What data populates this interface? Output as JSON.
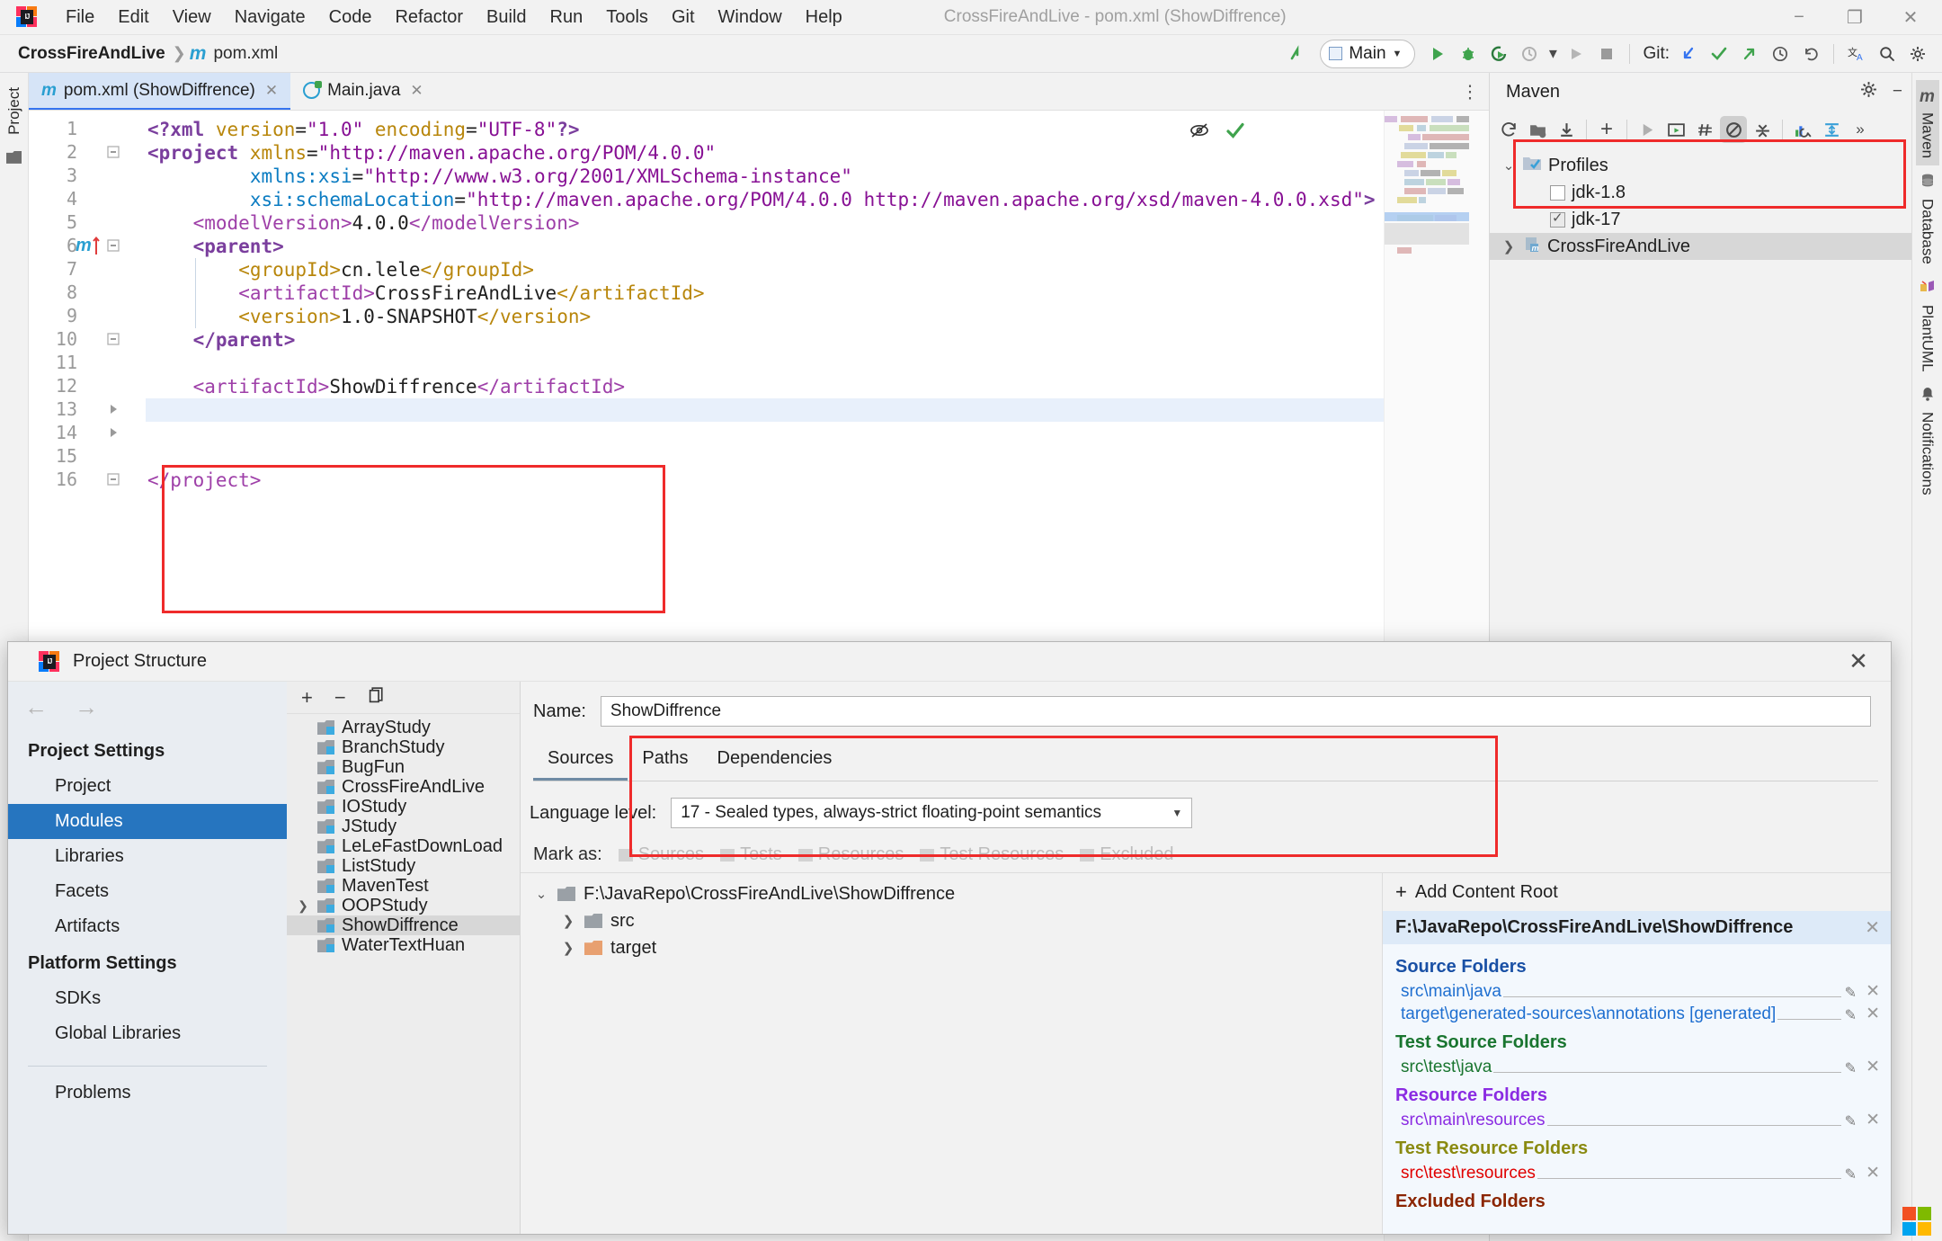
{
  "window": {
    "title": "CrossFireAndLive - pom.xml (ShowDiffrence)",
    "minimize": "−",
    "maximize": "❐",
    "close": "✕"
  },
  "menubar": [
    "File",
    "Edit",
    "View",
    "Navigate",
    "Code",
    "Refactor",
    "Build",
    "Run",
    "Tools",
    "Git",
    "Window",
    "Help"
  ],
  "navbar": {
    "breadcrumb_project": "CrossFireAndLive",
    "breadcrumb_sep": "❯",
    "breadcrumb_file": "pom.xml",
    "run_config": "Main",
    "git_label": "Git:"
  },
  "left_rail": {
    "project_tab": "Project"
  },
  "editor": {
    "tabs": [
      {
        "label": "pom.xml (ShowDiffrence)",
        "icon": "maven-xml-icon",
        "active": true
      },
      {
        "label": "Main.java",
        "icon": "java-class-icon",
        "active": false
      }
    ],
    "caret_line": 13,
    "lines": [
      {
        "n": 1,
        "segments": [
          {
            "t": "<?xml ",
            "c": "k-proc"
          },
          {
            "t": "version",
            "c": "k-orange"
          },
          {
            "t": "=",
            "c": "k-txt"
          },
          {
            "t": "\"1.0\"",
            "c": "k-purple"
          },
          {
            "t": " ",
            "c": "k-txt"
          },
          {
            "t": "encoding",
            "c": "k-orange"
          },
          {
            "t": "=",
            "c": "k-txt"
          },
          {
            "t": "\"UTF-8\"",
            "c": "k-purple"
          },
          {
            "t": "?>",
            "c": "k-proc"
          }
        ],
        "indent": 0
      },
      {
        "n": 2,
        "segments": [
          {
            "t": "<project",
            "c": "k-tagb"
          },
          {
            "t": " xmlns",
            "c": "k-orange"
          },
          {
            "t": "=",
            "c": "k-txt"
          },
          {
            "t": "\"http://maven.apache.org/POM/4.0.0\"",
            "c": "k-purple"
          }
        ],
        "indent": 0
      },
      {
        "n": 3,
        "segments": [
          {
            "t": "xmlns:xsi",
            "c": "k-blue"
          },
          {
            "t": "=",
            "c": "k-txt"
          },
          {
            "t": "\"http://www.w3.org/2001/XMLSchema-instance\"",
            "c": "k-purple"
          }
        ],
        "indent": 9
      },
      {
        "n": 4,
        "segments": [
          {
            "t": "xsi:schemaLocation",
            "c": "k-blue"
          },
          {
            "t": "=",
            "c": "k-txt"
          },
          {
            "t": "\"http://maven.apache.org/POM/4.0.0 http://maven.apache.org/xsd/maven-4.0.0.xsd\"",
            "c": "k-purple"
          },
          {
            "t": ">",
            "c": "k-tagb"
          }
        ],
        "indent": 9
      },
      {
        "n": 5,
        "segments": [
          {
            "t": "<modelVersion>",
            "c": "k-pink"
          },
          {
            "t": "4.0.0",
            "c": "k-txt"
          },
          {
            "t": "</modelVersion>",
            "c": "k-pink"
          }
        ],
        "indent": 4
      },
      {
        "n": 6,
        "segments": [
          {
            "t": "<parent>",
            "c": "k-tagb"
          }
        ],
        "indent": 4
      },
      {
        "n": 7,
        "segments": [
          {
            "t": "<groupId>",
            "c": "k-orange"
          },
          {
            "t": "cn.lele",
            "c": "k-txt"
          },
          {
            "t": "</groupId>",
            "c": "k-orange"
          }
        ],
        "indent": 8
      },
      {
        "n": 8,
        "segments": [
          {
            "t": "<artifactId>",
            "c": "k-pink"
          },
          {
            "t": "CrossFireAndLive",
            "c": "k-txt"
          },
          {
            "t": "</artifactId>",
            "c": "k-orange"
          }
        ],
        "indent": 8
      },
      {
        "n": 9,
        "segments": [
          {
            "t": "<version>",
            "c": "k-orange"
          },
          {
            "t": "1.0-SNAPSHOT",
            "c": "k-txt"
          },
          {
            "t": "</version>",
            "c": "k-orange"
          }
        ],
        "indent": 8
      },
      {
        "n": 10,
        "segments": [
          {
            "t": "</parent>",
            "c": "k-tagb"
          }
        ],
        "indent": 4
      },
      {
        "n": 11,
        "segments": [],
        "indent": 0
      },
      {
        "n": 12,
        "segments": [
          {
            "t": "<artifactId>",
            "c": "k-pink"
          },
          {
            "t": "ShowDiffrence",
            "c": "k-txt"
          },
          {
            "t": "</artifactId>",
            "c": "k-pink"
          }
        ],
        "indent": 4
      },
      {
        "n": 13,
        "segments": [],
        "indent": 0
      },
      {
        "n": 14,
        "segments": [],
        "indent": 0
      },
      {
        "n": 15,
        "segments": [],
        "indent": 0
      },
      {
        "n": 16,
        "segments": [
          {
            "t": "</project>",
            "c": "k-pink"
          }
        ],
        "indent": 0
      }
    ],
    "inspection_eye": "inspections-off-icon",
    "inspection_status": "✔"
  },
  "maven": {
    "title": "Maven",
    "settings_icon": "gear-icon",
    "hide_icon": "−",
    "toolbar": [
      "reload-icon",
      "add-maven-project-icon",
      "download-sources-icon",
      "plus-icon",
      "run-icon",
      "execute-goal-icon",
      "toggle-skip-tests-icon",
      "toggle-offline-icon",
      "collapse-all-icon",
      "analyze-dependencies-icon",
      "expand-icon",
      "more-icon"
    ],
    "tree": [
      {
        "label": "Profiles",
        "type": "group",
        "chevron": "⌄",
        "indent": 0
      },
      {
        "label": "jdk-1.8",
        "type": "checkbox",
        "checked": false,
        "indent": 1
      },
      {
        "label": "jdk-17",
        "type": "checkbox",
        "checked": true,
        "indent": 1
      },
      {
        "label": "CrossFireAndLive",
        "type": "project",
        "chevron": "❯",
        "indent": 0,
        "selected": true
      }
    ]
  },
  "right_rail": [
    {
      "label": "Maven",
      "icon": "maven-icon",
      "active": true
    },
    {
      "label": "Database",
      "icon": "database-icon",
      "active": false
    },
    {
      "label": "PlantUML",
      "icon": "plantuml-icon",
      "active": false
    },
    {
      "label": "Notifications",
      "icon": "bell-icon",
      "active": false
    }
  ],
  "project_structure": {
    "title": "Project Structure",
    "close": "✕",
    "nav_back": "←",
    "nav_forward": "→",
    "sections": [
      {
        "header": "Project Settings",
        "items": [
          {
            "label": "Project",
            "selected": false
          },
          {
            "label": "Modules",
            "selected": true
          },
          {
            "label": "Libraries",
            "selected": false
          },
          {
            "label": "Facets",
            "selected": false
          },
          {
            "label": "Artifacts",
            "selected": false
          }
        ]
      },
      {
        "header": "Platform Settings",
        "items": [
          {
            "label": "SDKs",
            "selected": false
          },
          {
            "label": "Global Libraries",
            "selected": false
          }
        ]
      }
    ],
    "problems_label": "Problems",
    "module_toolbar": {
      "add": "+",
      "remove": "−",
      "copy": "copy-icon"
    },
    "modules": [
      {
        "label": "ArrayStudy",
        "expandable": false,
        "selected": false
      },
      {
        "label": "BranchStudy",
        "expandable": false,
        "selected": false
      },
      {
        "label": "BugFun",
        "expandable": false,
        "selected": false
      },
      {
        "label": "CrossFireAndLive",
        "expandable": false,
        "selected": false
      },
      {
        "label": "IOStudy",
        "expandable": false,
        "selected": false
      },
      {
        "label": "JStudy",
        "expandable": false,
        "selected": false
      },
      {
        "label": "LeLeFastDownLoad",
        "expandable": false,
        "selected": false
      },
      {
        "label": "ListStudy",
        "expandable": false,
        "selected": false
      },
      {
        "label": "MavenTest",
        "expandable": false,
        "selected": false
      },
      {
        "label": "OOPStudy",
        "expandable": true,
        "selected": false
      },
      {
        "label": "ShowDiffrence",
        "expandable": false,
        "selected": true
      },
      {
        "label": "WaterTextHuan",
        "expandable": false,
        "selected": false
      }
    ],
    "name_label": "Name:",
    "name_value": "ShowDiffrence",
    "tabs": [
      {
        "label": "Sources",
        "active": true
      },
      {
        "label": "Paths",
        "active": false
      },
      {
        "label": "Dependencies",
        "active": false
      }
    ],
    "language_level_label": "Language level:",
    "language_level_value": "17 - Sealed types, always-strict floating-point semantics",
    "mark_as_label": "Mark as:",
    "mark_as_options": [
      "Sources",
      "Tests",
      "Resources",
      "Test Resources",
      "Excluded"
    ],
    "content_tree": [
      {
        "label": "F:\\JavaRepo\\CrossFireAndLive\\ShowDiffrence",
        "chevron": "⌄",
        "depth": 0,
        "color": "gray"
      },
      {
        "label": "src",
        "chevron": "❯",
        "depth": 1,
        "color": "gray"
      },
      {
        "label": "target",
        "chevron": "❯",
        "depth": 1,
        "color": "orange"
      }
    ],
    "add_content_root": "Add Content Root",
    "selected_root": "F:\\JavaRepo\\CrossFireAndLive\\ShowDiffrence",
    "folder_groups": [
      {
        "title": "Source Folders",
        "kind": "src",
        "paths": [
          "src\\main\\java",
          "target\\generated-sources\\annotations [generated]"
        ]
      },
      {
        "title": "Test Source Folders",
        "kind": "test",
        "paths": [
          "src\\test\\java"
        ]
      },
      {
        "title": "Resource Folders",
        "kind": "res",
        "paths": [
          "src\\main\\resources"
        ]
      },
      {
        "title": "Test Resource Folders",
        "kind": "tres",
        "paths": [
          "src\\test\\resources"
        ]
      },
      {
        "title": "Excluded Folders",
        "kind": "excl",
        "paths": []
      }
    ]
  },
  "colors": {
    "accent_blue": "#2675bf",
    "annotation_red": "#ef2b2b",
    "tab_active": "#d6e4f7",
    "selection_gray": "#d7d7d7"
  }
}
